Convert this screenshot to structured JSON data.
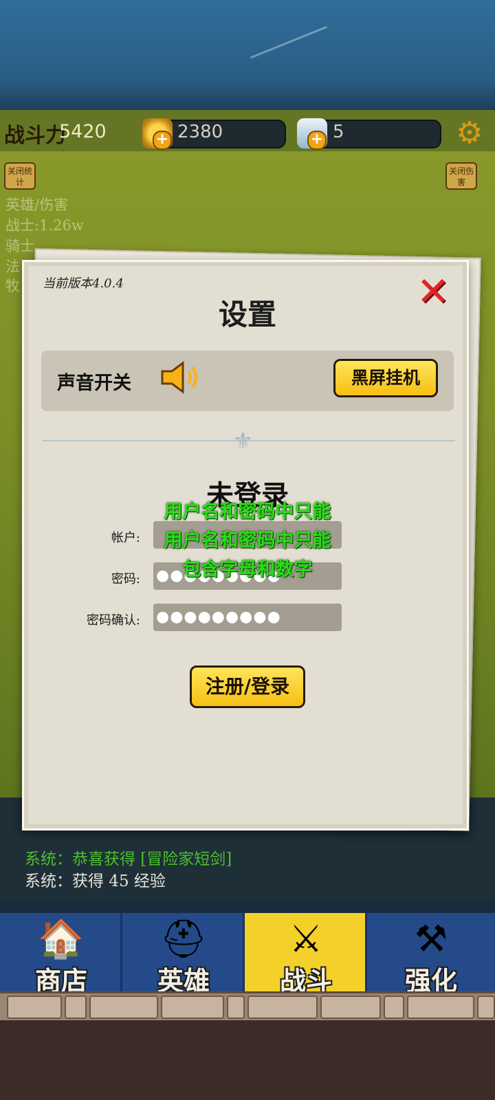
{
  "topbar": {
    "power_label": "战斗力",
    "power_value": "5420",
    "gold_value": "2380",
    "gem_value": "5",
    "left_toggle": "关闭统计",
    "right_toggle": "关闭伤害"
  },
  "stats_overlay": {
    "header": "英雄/伤害",
    "line1": "战士:1.26w",
    "line2": "骑士",
    "line3": "法",
    "line4": "牧"
  },
  "settings": {
    "version": "当前版本4.0.4",
    "title": "设置",
    "sound_label": "声音开关",
    "sound_icon": "speaker-icon",
    "black_screen_button": "黑屏挂机",
    "login_status": "未登录",
    "account_label": "帐户:",
    "password_label": "密码:",
    "confirm_label": "密码确认:",
    "account_value": "",
    "password_value": "●●●●●●●●●",
    "confirm_value": "●●●●●●●●●",
    "toast_line1": "用户名和密码中只能",
    "toast_line2": "用户名和密码中只能",
    "toast_line3": "包含字母和数字",
    "register_button": "注册/登录"
  },
  "system_log": {
    "line1": "系统：恭喜获得 [冒险家短剑]",
    "line2": "系统：获得 45 经验"
  },
  "nav": {
    "tabs": [
      {
        "label": "商店",
        "icon": "shop-icon"
      },
      {
        "label": "英雄",
        "icon": "hero-helmet-icon"
      },
      {
        "label": "战斗",
        "icon": "crossed-swords-icon"
      },
      {
        "label": "强化",
        "icon": "hammer-icon"
      }
    ],
    "active": "战斗"
  },
  "colors": {
    "accent_yellow": "#f7bf14",
    "close_red": "#e32323",
    "toast_green": "#2bdc1a",
    "nav_blue": "#244a8a"
  }
}
